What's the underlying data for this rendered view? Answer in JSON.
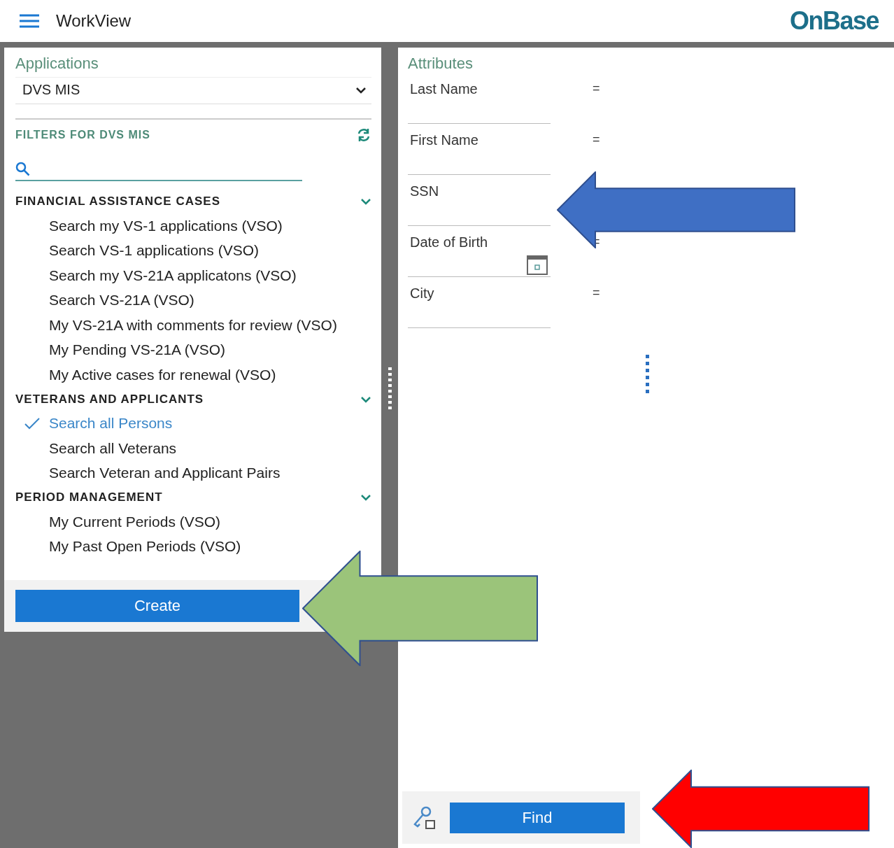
{
  "header": {
    "title": "WorkView",
    "logo": "OnBase"
  },
  "applications": {
    "label": "Applications",
    "value": "DVS MIS"
  },
  "filters": {
    "title": "FILTERS FOR DVS MIS",
    "groups": [
      {
        "title": "FINANCIAL ASSISTANCE CASES",
        "expanded": true,
        "items": [
          {
            "label": "Search my VS-1 applications (VSO)",
            "selected": false
          },
          {
            "label": "Search VS-1 applications (VSO)",
            "selected": false
          },
          {
            "label": "Search my VS-21A applicatons (VSO)",
            "selected": false
          },
          {
            "label": "Search VS-21A (VSO)",
            "selected": false
          },
          {
            "label": "My VS-21A with comments for review (VSO)",
            "selected": false
          },
          {
            "label": "My Pending VS-21A (VSO)",
            "selected": false
          },
          {
            "label": "My Active cases for renewal (VSO)",
            "selected": false
          }
        ]
      },
      {
        "title": "VETERANS AND APPLICANTS",
        "expanded": true,
        "items": [
          {
            "label": "Search all Persons",
            "selected": true
          },
          {
            "label": "Search all Veterans",
            "selected": false
          },
          {
            "label": "Search Veteran and Applicant Pairs",
            "selected": false
          }
        ]
      },
      {
        "title": "PERIOD MANAGEMENT",
        "expanded": true,
        "items": [
          {
            "label": "My Current Periods (VSO)",
            "selected": false
          },
          {
            "label": "My Past Open Periods (VSO)",
            "selected": false
          }
        ]
      }
    ]
  },
  "create_button": "Create",
  "attributes": {
    "title": "Attributes",
    "fields": [
      {
        "label": "Last Name",
        "kind": "text",
        "operator": "="
      },
      {
        "label": "First Name",
        "kind": "text",
        "operator": "="
      },
      {
        "label": "SSN",
        "kind": "text"
      },
      {
        "label": "Date of Birth",
        "kind": "date",
        "operator": "="
      },
      {
        "label": "City",
        "kind": "text",
        "operator": "="
      }
    ]
  },
  "find_button": "Find",
  "annotations": [
    {
      "kind": "arrow",
      "color": "#3f6fc4"
    },
    {
      "kind": "arrow",
      "color": "#9bc47a"
    },
    {
      "kind": "arrow",
      "color": "#ff0000"
    }
  ]
}
